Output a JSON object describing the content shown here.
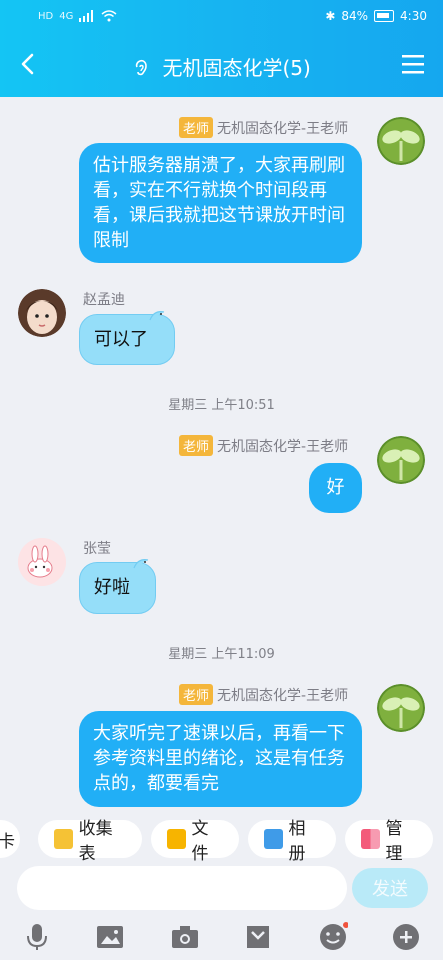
{
  "status_bar": {
    "left_icons": [
      "HD",
      "4G",
      "signal",
      "wifi"
    ],
    "battery": "84%",
    "time": "4:30"
  },
  "header": {
    "title": "无机固态化学(5)"
  },
  "messages": [
    {
      "badge": "老师",
      "sender": "无机固态化学-王老师",
      "text": "估计服务器崩溃了，大家再刷刷看，实在不行就换个时间段再看，课后我就把这节课放开时间限制"
    },
    {
      "sender": "赵孟迪",
      "text": "可以了"
    },
    {
      "badge": "老师",
      "sender": "无机固态化学-王老师",
      "text": "好"
    },
    {
      "sender": "张莹",
      "text": "好啦"
    },
    {
      "badge": "老师",
      "sender": "无机固态化学-王老师",
      "text": "大家听完了速课以后，再看一下参考资料里的绪论，这是有任务点的，都要看完"
    }
  ],
  "timestamps": [
    "星期三 上午10:51",
    "星期三 上午11:09"
  ],
  "quick_actions": [
    "卡",
    "收集表",
    "文件",
    "相册",
    "管理"
  ],
  "input": {
    "send_label": "发送"
  },
  "colors": {
    "accent": "#16b2f2",
    "bubble_teacher": "#21aff6",
    "bubble_student": "#95def9",
    "badge": "#f4b63b"
  },
  "toolbar_icons": [
    "mic-icon",
    "image-icon",
    "camera-icon",
    "cloud-file-icon",
    "emoji-icon",
    "plus-icon"
  ]
}
